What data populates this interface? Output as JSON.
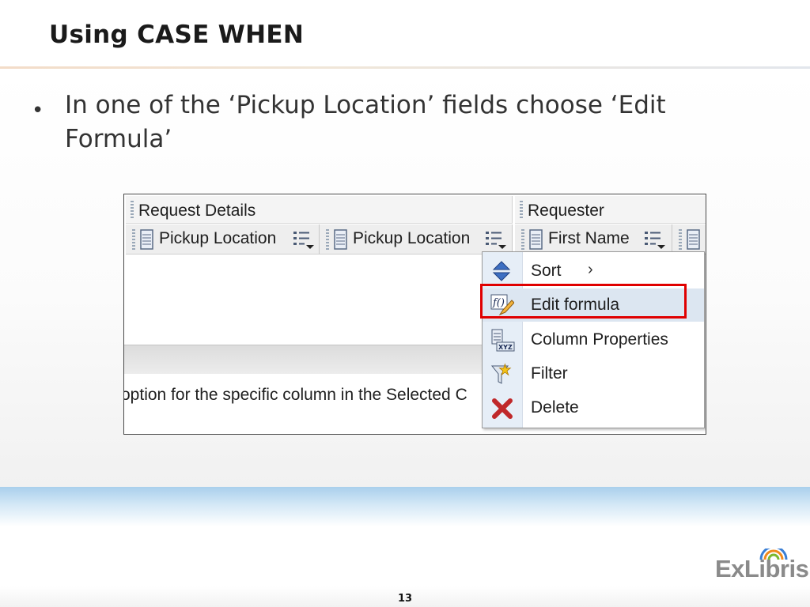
{
  "slide": {
    "title": "Using CASE WHEN",
    "bullet": "In one of the ‘Pickup Location’ fields choose ‘Edit Formula’",
    "page_number": "13",
    "logo_text": "ExLibris"
  },
  "screenshot": {
    "groups": [
      {
        "label": "Request Details"
      },
      {
        "label": "Requester"
      }
    ],
    "columns": [
      {
        "label": "Pickup Location"
      },
      {
        "label": "Pickup Location"
      },
      {
        "label": "First Name"
      }
    ],
    "hint_text": "option for the specific column in the Selected C",
    "menu": {
      "items": [
        {
          "label": "Sort",
          "icon": "sort-icon",
          "has_submenu": true
        },
        {
          "label": "Edit formula",
          "icon": "edit-formula-icon",
          "highlighted": true
        },
        {
          "label": "Column Properties",
          "icon": "column-properties-icon"
        },
        {
          "label": "Filter",
          "icon": "filter-icon"
        },
        {
          "label": "Delete",
          "icon": "delete-icon"
        }
      ],
      "submenu_arrow": "›"
    }
  },
  "colors": {
    "highlight_border": "#e00000",
    "menu_gutter": "#e6eef7",
    "menu_hover": "#dce6f1",
    "footer_band": "#a9cfec"
  }
}
